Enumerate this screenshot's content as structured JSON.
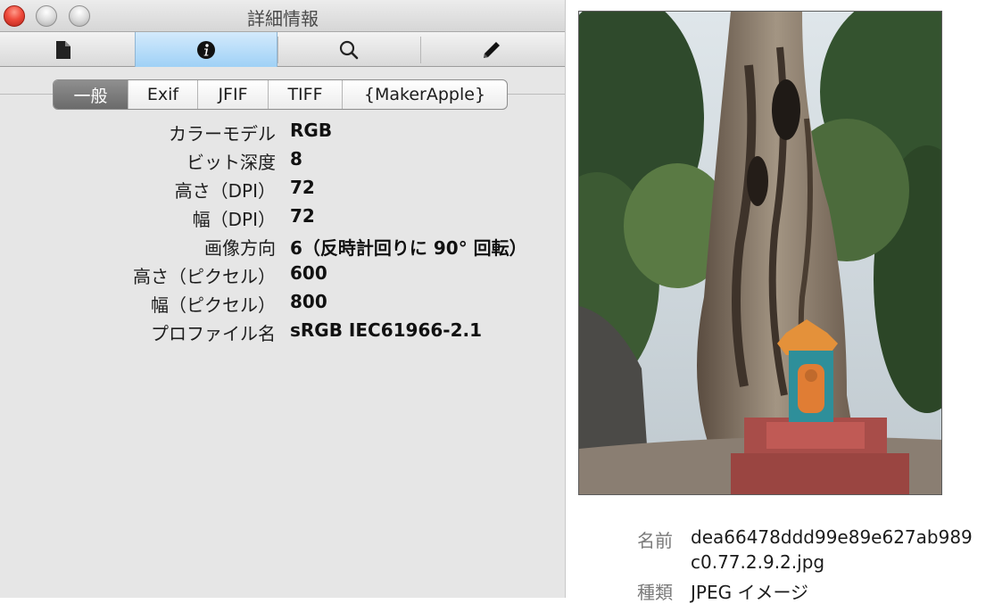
{
  "window": {
    "title": "詳細情報"
  },
  "toolbar": {
    "items": [
      {
        "icon": "document-icon"
      },
      {
        "icon": "info-icon",
        "selected": true
      },
      {
        "icon": "search-icon"
      },
      {
        "icon": "pencil-icon"
      }
    ]
  },
  "tabs": [
    "一般",
    "Exif",
    "JFIF",
    "TIFF",
    "{MakerApple}"
  ],
  "properties": [
    {
      "label": "カラーモデル",
      "value": "RGB"
    },
    {
      "label": "ビット深度",
      "value": "8"
    },
    {
      "label": "高さ（DPI）",
      "value": "72"
    },
    {
      "label": "幅（DPI）",
      "value": "72"
    },
    {
      "label": "画像方向",
      "value": "6（反時計回りに 90° 回転）"
    },
    {
      "label": "高さ（ピクセル）",
      "value": "600"
    },
    {
      "label": "幅（ピクセル）",
      "value": "800"
    },
    {
      "label": "プロファイル名",
      "value": "sRGB IEC61966-2.1"
    }
  ],
  "file_info": {
    "name_label": "名前",
    "name_value_line1": "dea66478ddd99e89e627ab989",
    "name_value_line2": "c0.77.2.9.2.jpg",
    "kind_label": "種類",
    "kind_value": "JPEG イメージ"
  },
  "colors": {
    "selected_toolbar": "#9fd1f6",
    "active_tab": "#7a7a7a",
    "close_button": "#ef4b3c"
  }
}
